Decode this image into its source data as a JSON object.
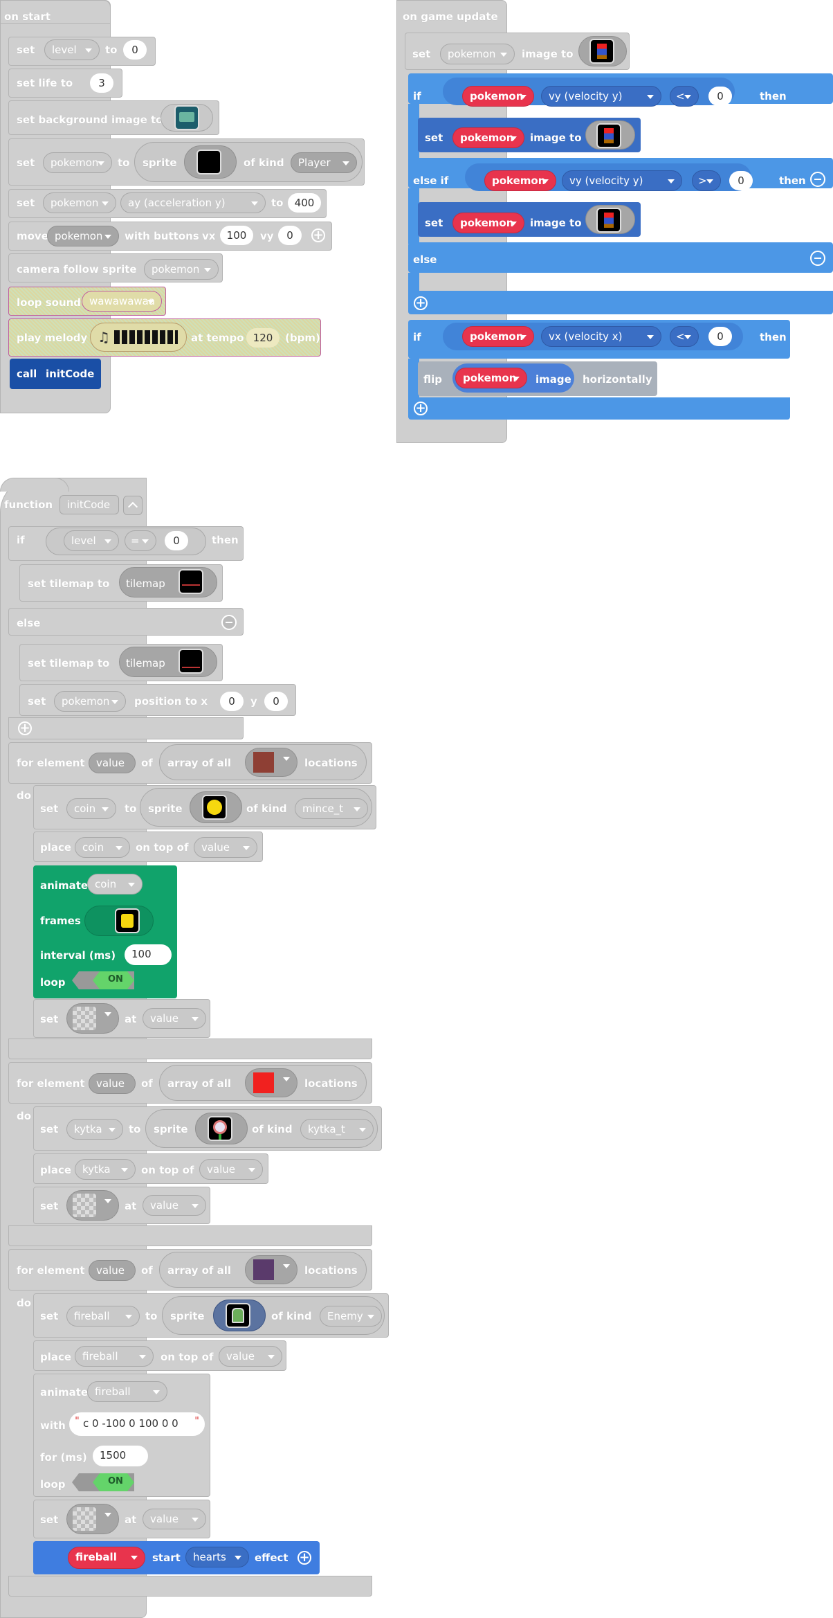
{
  "on_start": {
    "hat": "on start",
    "set": "set",
    "to": "to",
    "level_var": "level",
    "level_value": "0",
    "set_life": "set life to",
    "life_value": "3",
    "set_bg": "set background image to",
    "pokemon_var": "pokemon",
    "sprite": "sprite",
    "of_kind": "of kind",
    "kind_player": "Player",
    "ay_prop": "ay (acceleration y)",
    "ay_value": "400",
    "move": "move",
    "with_buttons": "with buttons",
    "vx_label": "vx",
    "vx_value": "100",
    "vy_label": "vy",
    "vy_value": "0",
    "camera": "camera follow sprite",
    "loop_sound": "loop sound",
    "sound_value": "wawawawaa",
    "play_melody": "play melody",
    "at_tempo": "at tempo",
    "tempo_value": "120",
    "bpm": "(bpm)",
    "call": "call",
    "call_fn": "initCode"
  },
  "on_game_update": {
    "hat": "on game update",
    "set": "set",
    "image_to": "image to",
    "if": "if",
    "else_if": "else if",
    "else": "else",
    "then": "then",
    "pokemon_var": "pokemon",
    "vy_prop": "vy (velocity y)",
    "vx_prop": "vx (velocity x)",
    "op_lt": "<",
    "op_gt": ">",
    "zero": "0",
    "flip": "flip",
    "image": "image",
    "horizontally": "horizontally"
  },
  "function": {
    "function": "function",
    "name": "initCode",
    "if": "if",
    "then": "then",
    "else": "else",
    "level_var": "level",
    "op_eq": "=",
    "zero": "0",
    "set_tilemap": "set tilemap to",
    "tilemap": "tilemap",
    "set": "set",
    "pokemon_var": "pokemon",
    "position_to_x": "position to x",
    "y": "y",
    "for_element": "for element",
    "value": "value",
    "of": "of",
    "array_of_all": "array of all",
    "locations": "locations",
    "do": "do",
    "to": "to",
    "sprite": "sprite",
    "of_kind": "of kind",
    "place": "place",
    "on_top_of": "on top of",
    "at": "at",
    "coin_var": "coin",
    "coin_kind": "mince_t",
    "animate": "animate",
    "frames": "frames",
    "interval": "interval (ms)",
    "interval_value": "100",
    "loop": "loop",
    "on": "ON",
    "kytka_var": "kytka",
    "kytka_kind": "kytka_t",
    "fireball_var": "fireball",
    "fireball_kind": "Enemy",
    "with": "with",
    "path_value": "c 0 -100 0 100 0 0",
    "for_ms": "for (ms)",
    "for_ms_value": "1500",
    "start": "start",
    "effect_value": "hearts",
    "effect": "effect"
  },
  "colors": {
    "gray_block": "#cfcfcf",
    "blue_block": "#4c97e6",
    "sprite_red": "#e8344d",
    "green_animate": "#11a36b",
    "call_blue": "#1a4fa6",
    "tile_brown": "#8e3f34",
    "tile_red": "#f1211f",
    "tile_purple": "#5a3a6b"
  }
}
